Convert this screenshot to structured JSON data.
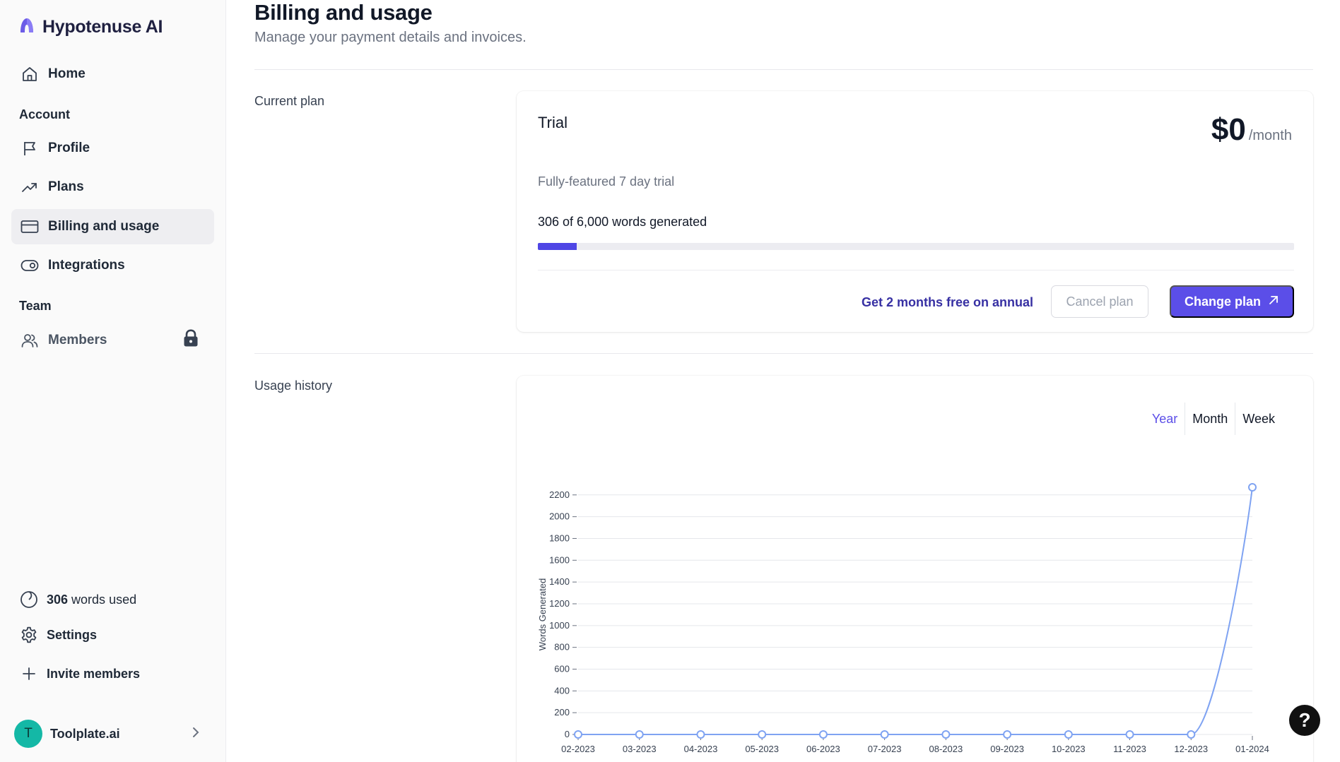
{
  "app": {
    "name": "Hypotenuse AI"
  },
  "colors": {
    "accent": "#5b4ee8",
    "progress": "#4f46e5",
    "chart_line": "#7fa3f2",
    "avatar": "#14b8a6"
  },
  "sidebar": {
    "home": "Home",
    "account_label": "Account",
    "profile": "Profile",
    "plans": "Plans",
    "billing": "Billing and usage",
    "integrations": "Integrations",
    "team_label": "Team",
    "members": "Members",
    "words_used_count": "306",
    "words_used_text": "words used",
    "settings": "Settings",
    "invite": "Invite members",
    "account_initial": "T",
    "account_name": "Toolplate.ai"
  },
  "page": {
    "title": "Billing and usage",
    "subtitle": "Manage your payment details and invoices."
  },
  "current_plan": {
    "label": "Current plan",
    "name": "Trial",
    "price": "$0",
    "period": "/month",
    "description": "Fully-featured 7 day trial",
    "usage_text": "306 of 6,000 words generated",
    "words_used": 306,
    "words_limit": 6000,
    "annual_link": "Get 2 months free on annual",
    "cancel_button": "Cancel plan",
    "change_button": "Change plan"
  },
  "usage_history": {
    "label": "Usage history",
    "ranges": [
      "Year",
      "Month",
      "Week"
    ],
    "selected_range": "Year"
  },
  "chart_data": {
    "type": "line",
    "x": [
      "02-2023",
      "03-2023",
      "04-2023",
      "05-2023",
      "06-2023",
      "07-2023",
      "08-2023",
      "09-2023",
      "10-2023",
      "11-2023",
      "12-2023",
      "01-2024"
    ],
    "values": [
      0,
      0,
      0,
      0,
      0,
      0,
      0,
      0,
      0,
      0,
      0,
      2270
    ],
    "ylabel": "Words Generated",
    "yticks": [
      0,
      200,
      400,
      600,
      800,
      1000,
      1200,
      1400,
      1600,
      1800,
      2000,
      2200
    ],
    "ylim": [
      0,
      2270
    ],
    "grid": true
  },
  "help": {
    "label": "?"
  }
}
